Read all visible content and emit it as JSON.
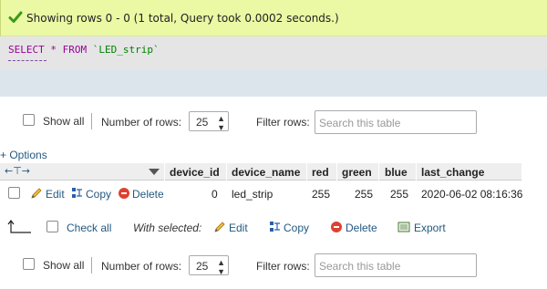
{
  "success_message": "Showing rows 0 - 0 (1 total, Query took 0.0002 seconds.)",
  "sql": {
    "select": "SELECT",
    "star": "*",
    "from": "FROM",
    "table": "`LED_strip`"
  },
  "nav_top": {
    "show_all": "Show all",
    "number_of_rows_label": "Number of rows:",
    "rows_value": "25",
    "filter_label": "Filter rows:",
    "filter_placeholder": "Search this table"
  },
  "options_link": "+ Options",
  "table": {
    "columns": [
      "device_id",
      "device_name",
      "red",
      "green",
      "blue",
      "last_change"
    ],
    "rows": [
      {
        "actions": {
          "edit": "Edit",
          "copy": "Copy",
          "delete": "Delete"
        },
        "device_id": "0",
        "device_name": "led_strip",
        "red": "255",
        "green": "255",
        "blue": "255",
        "last_change": "2020-06-02 08:16:36"
      }
    ]
  },
  "bulk": {
    "check_all": "Check all",
    "with_selected": "With selected:",
    "edit": "Edit",
    "copy": "Copy",
    "delete": "Delete",
    "export": "Export"
  },
  "nav_bottom": {
    "show_all": "Show all",
    "number_of_rows_label": "Number of rows:",
    "rows_value": "25",
    "filter_label": "Filter rows:",
    "filter_placeholder": "Search this table"
  }
}
